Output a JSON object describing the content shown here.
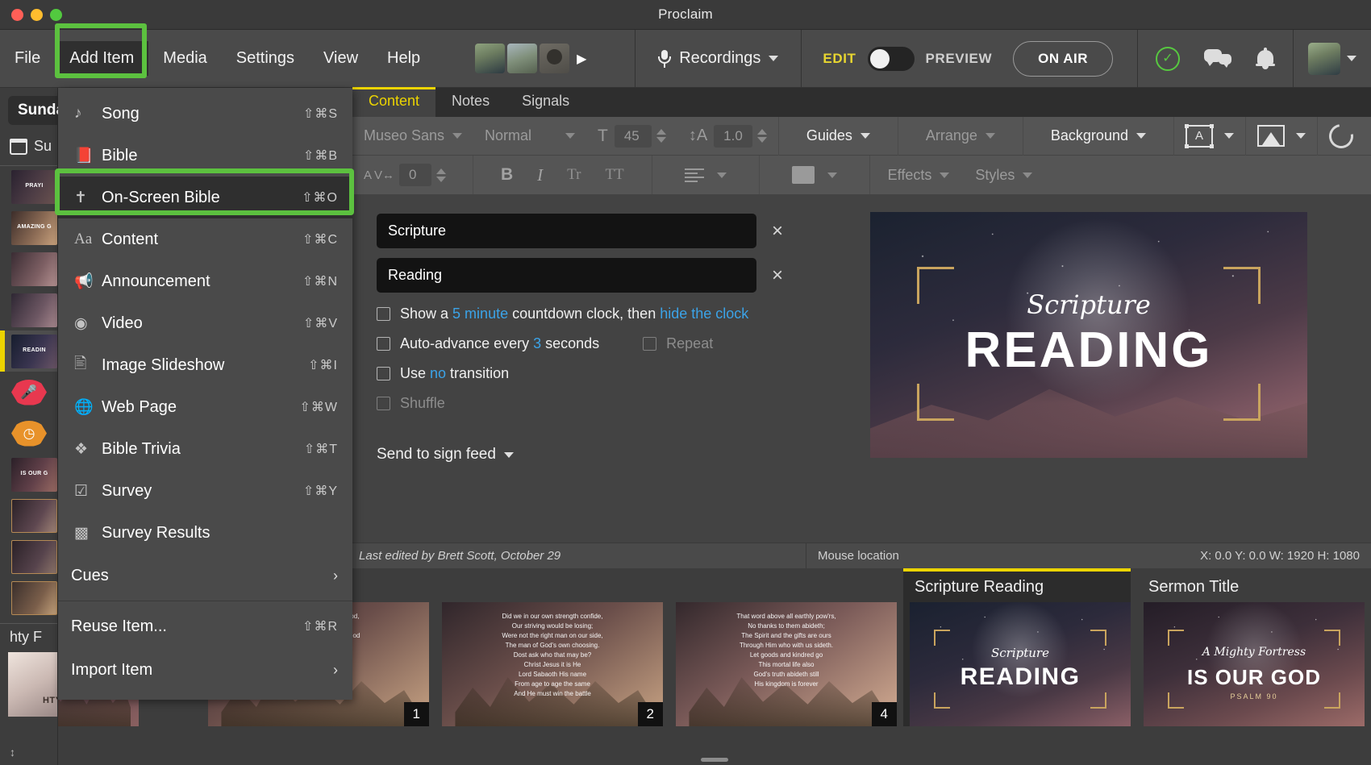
{
  "window": {
    "title": "Proclaim"
  },
  "menubar": {
    "items": [
      "File",
      "Add Item",
      "Media",
      "Settings",
      "View",
      "Help"
    ],
    "active_item": "Add Item",
    "recordings_label": "Recordings",
    "edit_label": "EDIT",
    "preview_label": "PREVIEW",
    "on_air_label": "ON AIR"
  },
  "add_item_menu": {
    "items": [
      {
        "icon": "music-note-icon",
        "label": "Song",
        "shortcut": "⇧⌘S"
      },
      {
        "icon": "bible-book-icon",
        "label": "Bible",
        "shortcut": "⇧⌘B"
      },
      {
        "icon": "cross-icon",
        "label": "On-Screen Bible",
        "shortcut": "⇧⌘O"
      },
      {
        "icon": "text-aa-icon",
        "label": "Content",
        "shortcut": "⇧⌘C"
      },
      {
        "icon": "megaphone-icon",
        "label": "Announcement",
        "shortcut": "⇧⌘N"
      },
      {
        "icon": "play-circle-icon",
        "label": "Video",
        "shortcut": "⇧⌘V"
      },
      {
        "icon": "images-stack-icon",
        "label": "Image Slideshow",
        "shortcut": "⇧⌘I"
      },
      {
        "icon": "globe-cursor-icon",
        "label": "Web Page",
        "shortcut": "⇧⌘W"
      },
      {
        "icon": "trivia-wheel-icon",
        "label": "Bible Trivia",
        "shortcut": "⇧⌘T"
      },
      {
        "icon": "checkbox-icon",
        "label": "Survey",
        "shortcut": "⇧⌘Y"
      },
      {
        "icon": "bar-chart-icon",
        "label": "Survey Results",
        "shortcut": ""
      }
    ],
    "highlighted_item": "On-Screen Bible",
    "submenu_items": [
      {
        "label": "Cues",
        "arrow": "›"
      }
    ],
    "footer_items": [
      {
        "label": "Reuse Item...",
        "shortcut": "⇧⌘R",
        "arrow": ""
      },
      {
        "label": "Import Item",
        "shortcut": "",
        "arrow": "›"
      }
    ],
    "highlight_color": "#5cc13f"
  },
  "sidebar": {
    "service_name": "Sunday",
    "service_date": "Su",
    "bottom_section_label": "hty F",
    "items": [
      {
        "name": "prayer-slide",
        "caption": "PRAYI"
      },
      {
        "name": "amazing-slide",
        "caption": "AMAZING G"
      },
      {
        "name": "song-slide-3",
        "caption": ""
      },
      {
        "name": "song-slide-4",
        "caption": ""
      },
      {
        "name": "scripture-reading-slide",
        "caption": "READIN",
        "selected": true
      },
      {
        "name": "recording-badge",
        "icon": "microphone-icon",
        "color": "#e8384f"
      },
      {
        "name": "countdown-badge",
        "icon": "clock-icon",
        "color": "#e8922a"
      },
      {
        "name": "sermon-title-slide",
        "caption": "IS OUR G"
      },
      {
        "name": "sermon-slide-2",
        "caption": ""
      },
      {
        "name": "sermon-slide-3",
        "caption": ""
      },
      {
        "name": "sermon-slide-4",
        "caption": ""
      }
    ],
    "bottom_thumb_caption": "HTY F"
  },
  "editor": {
    "tabs": [
      {
        "label": "Content",
        "active": true
      },
      {
        "label": "Notes",
        "active": false
      },
      {
        "label": "Signals",
        "active": false
      }
    ],
    "toolbar_row1": {
      "font_family": "Museo Sans",
      "font_style": "Normal",
      "font_size_icon": "font-size-icon",
      "font_size": "45",
      "line_height_icon": "line-height-icon",
      "line_height": "1.0",
      "guides_label": "Guides",
      "arrange_label": "Arrange",
      "background_label": "Background",
      "text_frame_icon": "text-frame-icon",
      "image_fill_icon": "image-fill-icon",
      "reset_icon": "reset-icon"
    },
    "toolbar_row2": {
      "tracking_icon": "letter-spacing-icon",
      "tracking_value": "0",
      "bold_label": "B",
      "italic_label": "I",
      "smallcaps_label": "Tr",
      "allcaps_label": "TT",
      "align_icon": "text-align-icon",
      "color_icon": "text-color-icon",
      "effects_label": "Effects",
      "styles_label": "Styles"
    },
    "fields": [
      {
        "name": "line-1",
        "value": "Scripture",
        "clear": "×"
      },
      {
        "name": "line-2",
        "value": "Reading",
        "clear": "×"
      }
    ],
    "options": [
      {
        "name": "countdown-clock",
        "checked": false,
        "parts": [
          {
            "text": "Show a ",
            "style": "normal"
          },
          {
            "text": "5 minute",
            "style": "link"
          },
          {
            "text": " countdown clock, then ",
            "style": "normal"
          },
          {
            "text": "hide the clock",
            "style": "link"
          }
        ]
      },
      {
        "name": "auto-advance",
        "checked": false,
        "parts": [
          {
            "text": "Auto-advance every ",
            "style": "normal"
          },
          {
            "text": "3",
            "style": "link"
          },
          {
            "text": " seconds",
            "style": "normal"
          }
        ]
      },
      {
        "name": "use-transition",
        "checked": false,
        "parts": [
          {
            "text": "Use ",
            "style": "normal"
          },
          {
            "text": "no",
            "style": "link"
          },
          {
            "text": " transition",
            "style": "normal"
          }
        ]
      },
      {
        "name": "shuffle",
        "checked": false,
        "disabled": true,
        "parts": [
          {
            "text": "Shuffle",
            "style": "disabled"
          }
        ]
      }
    ],
    "repeat_label": "Repeat",
    "sign_feed_label": "Send to sign feed",
    "slide_preview": {
      "script_text": "Scripture",
      "main_text": "READING"
    }
  },
  "status_bar": {
    "last_edited": "Last edited by Brett Scott, October 29",
    "mouse_location_label": "Mouse location",
    "coords": "X: 0.0  Y: 0.0     W: 1920  H: 1080"
  },
  "filmstrip": {
    "cards": [
      {
        "name": "slide-partial",
        "title": "",
        "number": "",
        "verse": ""
      },
      {
        "name": "slide-1",
        "title": "",
        "number": "1",
        "verse": "A mighty fortress is our God,\nA bulwark never failing;\nOur helper He amid the flood\nOf mortal ills prevailing."
      },
      {
        "name": "slide-2",
        "title": "",
        "number": "2",
        "verse": "Did we in our own strength confide,\nOur striving would be losing;\nWere not the right man on our side,\nThe man of God's own choosing.\nDost ask who that may be?\nChrist Jesus it is He\nLord Sabaoth His name\nFrom age to age the same\nAnd He must win the battle"
      },
      {
        "name": "slide-4",
        "title": "",
        "number": "4",
        "verse": "That word above all earthly pow'rs,\nNo thanks to them abideth;\nThe Spirit and the gifts are ours\nThrough Him who with us sideth.\nLet goods and kindred go\nThis mortal life also\nGod's truth abideth still\nHis kingdom is forever"
      },
      {
        "name": "scripture-reading-card",
        "title": "Scripture Reading",
        "number": "",
        "selected": true,
        "script_text": "Scripture",
        "main_text": "READING"
      },
      {
        "name": "sermon-title-card",
        "title": "Sermon Title",
        "number": "",
        "script_text": "A Mighty Fortress",
        "main_text": "IS OUR GOD",
        "sub_text": "PSALM 90"
      }
    ]
  }
}
